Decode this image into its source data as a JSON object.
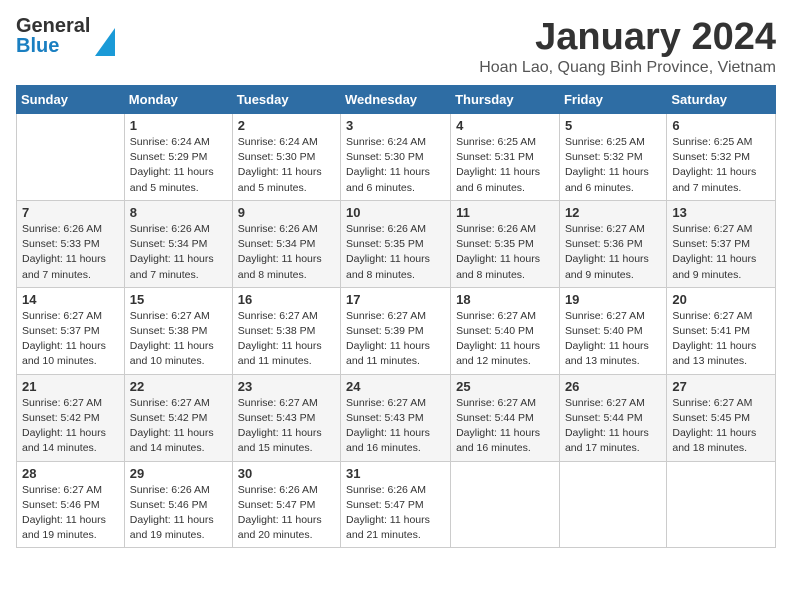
{
  "logo": {
    "general": "General",
    "blue": "Blue"
  },
  "title": "January 2024",
  "location": "Hoan Lao, Quang Binh Province, Vietnam",
  "days_of_week": [
    "Sunday",
    "Monday",
    "Tuesday",
    "Wednesday",
    "Thursday",
    "Friday",
    "Saturday"
  ],
  "weeks": [
    [
      {
        "day": "",
        "sunrise": "",
        "sunset": "",
        "daylight": ""
      },
      {
        "day": "1",
        "sunrise": "Sunrise: 6:24 AM",
        "sunset": "Sunset: 5:29 PM",
        "daylight": "Daylight: 11 hours and 5 minutes."
      },
      {
        "day": "2",
        "sunrise": "Sunrise: 6:24 AM",
        "sunset": "Sunset: 5:30 PM",
        "daylight": "Daylight: 11 hours and 5 minutes."
      },
      {
        "day": "3",
        "sunrise": "Sunrise: 6:24 AM",
        "sunset": "Sunset: 5:30 PM",
        "daylight": "Daylight: 11 hours and 6 minutes."
      },
      {
        "day": "4",
        "sunrise": "Sunrise: 6:25 AM",
        "sunset": "Sunset: 5:31 PM",
        "daylight": "Daylight: 11 hours and 6 minutes."
      },
      {
        "day": "5",
        "sunrise": "Sunrise: 6:25 AM",
        "sunset": "Sunset: 5:32 PM",
        "daylight": "Daylight: 11 hours and 6 minutes."
      },
      {
        "day": "6",
        "sunrise": "Sunrise: 6:25 AM",
        "sunset": "Sunset: 5:32 PM",
        "daylight": "Daylight: 11 hours and 7 minutes."
      }
    ],
    [
      {
        "day": "7",
        "sunrise": "Sunrise: 6:26 AM",
        "sunset": "Sunset: 5:33 PM",
        "daylight": "Daylight: 11 hours and 7 minutes."
      },
      {
        "day": "8",
        "sunrise": "Sunrise: 6:26 AM",
        "sunset": "Sunset: 5:34 PM",
        "daylight": "Daylight: 11 hours and 7 minutes."
      },
      {
        "day": "9",
        "sunrise": "Sunrise: 6:26 AM",
        "sunset": "Sunset: 5:34 PM",
        "daylight": "Daylight: 11 hours and 8 minutes."
      },
      {
        "day": "10",
        "sunrise": "Sunrise: 6:26 AM",
        "sunset": "Sunset: 5:35 PM",
        "daylight": "Daylight: 11 hours and 8 minutes."
      },
      {
        "day": "11",
        "sunrise": "Sunrise: 6:26 AM",
        "sunset": "Sunset: 5:35 PM",
        "daylight": "Daylight: 11 hours and 8 minutes."
      },
      {
        "day": "12",
        "sunrise": "Sunrise: 6:27 AM",
        "sunset": "Sunset: 5:36 PM",
        "daylight": "Daylight: 11 hours and 9 minutes."
      },
      {
        "day": "13",
        "sunrise": "Sunrise: 6:27 AM",
        "sunset": "Sunset: 5:37 PM",
        "daylight": "Daylight: 11 hours and 9 minutes."
      }
    ],
    [
      {
        "day": "14",
        "sunrise": "Sunrise: 6:27 AM",
        "sunset": "Sunset: 5:37 PM",
        "daylight": "Daylight: 11 hours and 10 minutes."
      },
      {
        "day": "15",
        "sunrise": "Sunrise: 6:27 AM",
        "sunset": "Sunset: 5:38 PM",
        "daylight": "Daylight: 11 hours and 10 minutes."
      },
      {
        "day": "16",
        "sunrise": "Sunrise: 6:27 AM",
        "sunset": "Sunset: 5:38 PM",
        "daylight": "Daylight: 11 hours and 11 minutes."
      },
      {
        "day": "17",
        "sunrise": "Sunrise: 6:27 AM",
        "sunset": "Sunset: 5:39 PM",
        "daylight": "Daylight: 11 hours and 11 minutes."
      },
      {
        "day": "18",
        "sunrise": "Sunrise: 6:27 AM",
        "sunset": "Sunset: 5:40 PM",
        "daylight": "Daylight: 11 hours and 12 minutes."
      },
      {
        "day": "19",
        "sunrise": "Sunrise: 6:27 AM",
        "sunset": "Sunset: 5:40 PM",
        "daylight": "Daylight: 11 hours and 13 minutes."
      },
      {
        "day": "20",
        "sunrise": "Sunrise: 6:27 AM",
        "sunset": "Sunset: 5:41 PM",
        "daylight": "Daylight: 11 hours and 13 minutes."
      }
    ],
    [
      {
        "day": "21",
        "sunrise": "Sunrise: 6:27 AM",
        "sunset": "Sunset: 5:42 PM",
        "daylight": "Daylight: 11 hours and 14 minutes."
      },
      {
        "day": "22",
        "sunrise": "Sunrise: 6:27 AM",
        "sunset": "Sunset: 5:42 PM",
        "daylight": "Daylight: 11 hours and 14 minutes."
      },
      {
        "day": "23",
        "sunrise": "Sunrise: 6:27 AM",
        "sunset": "Sunset: 5:43 PM",
        "daylight": "Daylight: 11 hours and 15 minutes."
      },
      {
        "day": "24",
        "sunrise": "Sunrise: 6:27 AM",
        "sunset": "Sunset: 5:43 PM",
        "daylight": "Daylight: 11 hours and 16 minutes."
      },
      {
        "day": "25",
        "sunrise": "Sunrise: 6:27 AM",
        "sunset": "Sunset: 5:44 PM",
        "daylight": "Daylight: 11 hours and 16 minutes."
      },
      {
        "day": "26",
        "sunrise": "Sunrise: 6:27 AM",
        "sunset": "Sunset: 5:44 PM",
        "daylight": "Daylight: 11 hours and 17 minutes."
      },
      {
        "day": "27",
        "sunrise": "Sunrise: 6:27 AM",
        "sunset": "Sunset: 5:45 PM",
        "daylight": "Daylight: 11 hours and 18 minutes."
      }
    ],
    [
      {
        "day": "28",
        "sunrise": "Sunrise: 6:27 AM",
        "sunset": "Sunset: 5:46 PM",
        "daylight": "Daylight: 11 hours and 19 minutes."
      },
      {
        "day": "29",
        "sunrise": "Sunrise: 6:26 AM",
        "sunset": "Sunset: 5:46 PM",
        "daylight": "Daylight: 11 hours and 19 minutes."
      },
      {
        "day": "30",
        "sunrise": "Sunrise: 6:26 AM",
        "sunset": "Sunset: 5:47 PM",
        "daylight": "Daylight: 11 hours and 20 minutes."
      },
      {
        "day": "31",
        "sunrise": "Sunrise: 6:26 AM",
        "sunset": "Sunset: 5:47 PM",
        "daylight": "Daylight: 11 hours and 21 minutes."
      },
      {
        "day": "",
        "sunrise": "",
        "sunset": "",
        "daylight": ""
      },
      {
        "day": "",
        "sunrise": "",
        "sunset": "",
        "daylight": ""
      },
      {
        "day": "",
        "sunrise": "",
        "sunset": "",
        "daylight": ""
      }
    ]
  ]
}
